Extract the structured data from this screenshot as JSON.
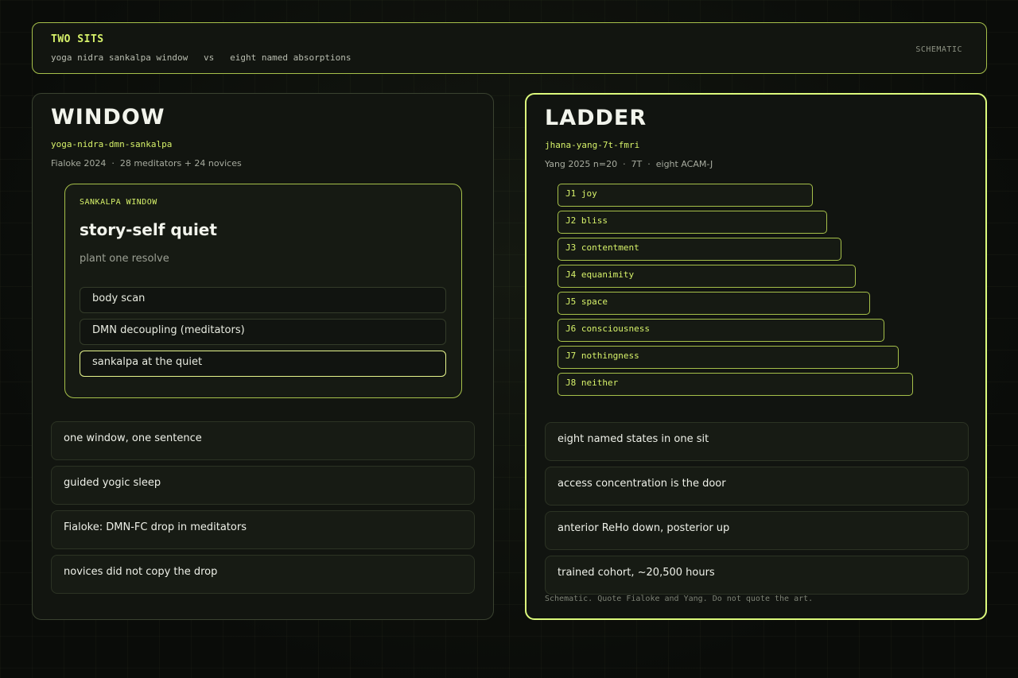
{
  "header": {
    "title": "TWO SITS",
    "subtitle": "yoga nidra sankalpa window   vs   eight named absorptions",
    "tag": "SCHEMATIC"
  },
  "left": {
    "title": "WINDOW",
    "code": "yoga-nidra-dmn-sankalpa",
    "meta": "Fialoke 2024  ·  28 meditators + 24 novices",
    "window": {
      "label": "SANKALPA WINDOW",
      "title": "story-self quiet",
      "subtitle": "plant one resolve",
      "steps": [
        {
          "label": "body scan"
        },
        {
          "label": "DMN decoupling (meditators)"
        },
        {
          "label": "sankalpa at the quiet"
        }
      ]
    },
    "notes": [
      "one window, one sentence",
      "guided yogic sleep",
      "Fialoke: DMN-FC drop in meditators",
      "novices did not copy the drop"
    ]
  },
  "right": {
    "title": "LADDER",
    "code": "jhana-yang-7t-fmri",
    "meta": "Yang 2025 n=20  ·  7T  ·  eight ACAM-J",
    "ladder": [
      "J1 joy",
      "J2 bliss",
      "J3 contentment",
      "J4 equanimity",
      "J5 space",
      "J6 consciousness",
      "J7 nothingness",
      "J8 neither"
    ],
    "notes": [
      "eight named states in one sit",
      "access concentration is the door",
      "anterior ReHo down, posterior up",
      "trained cohort, ~20,500 hours"
    ],
    "footnote": "Schematic. Quote Fialoke and Yang. Do not quote the art."
  },
  "colors": {
    "accent": "#d7f26a",
    "border_accent": "#a6c04a",
    "highlight_border": "#dcfa7c",
    "background": "#0b0d0a"
  }
}
